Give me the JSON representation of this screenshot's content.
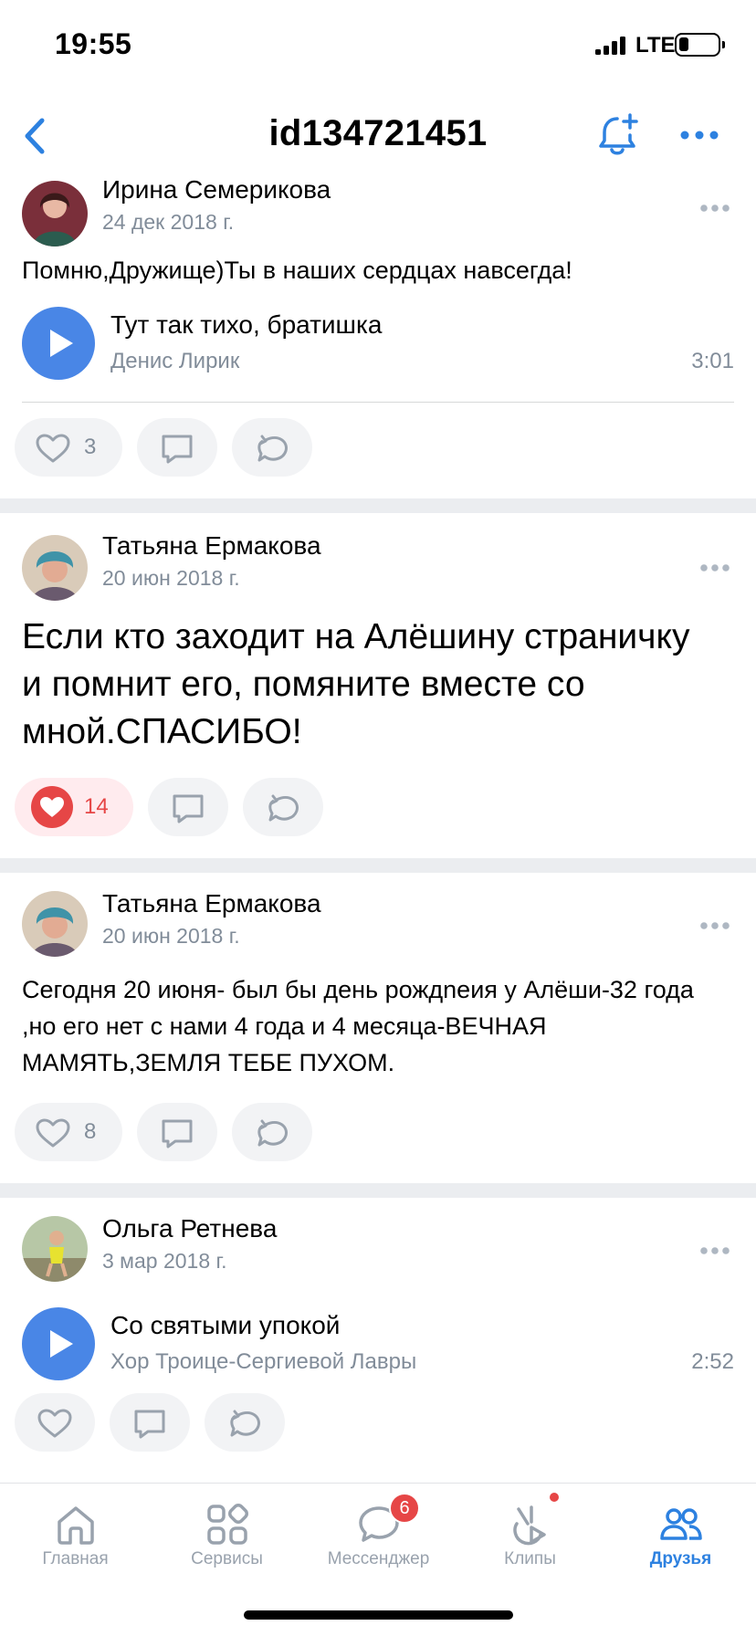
{
  "status_bar": {
    "time": "19:55",
    "network": "LTE",
    "battery_level": 0.15
  },
  "nav": {
    "title": "id134721451",
    "back_icon": "chevron-left-icon",
    "bell_icon": "bell-plus-icon",
    "more_icon": "more-horizontal-icon"
  },
  "posts": [
    {
      "author": "Ирина Семерикова",
      "date": "24 дек 2018 г.",
      "text": "Помню,Дружище)Ты в наших сердцах навсегда!",
      "audio": {
        "title": "Тут так тихо, братишка",
        "artist": "Денис Лирик",
        "duration": "3:01"
      },
      "likes": "3",
      "liked": false
    },
    {
      "author": "Татьяна Ермакова",
      "date": "20 июн 2018 г.",
      "text": "Если кто заходит на Алёшину страничку и помнит его, помяните вместе со мной.СПАСИБО!",
      "likes": "14",
      "liked": true
    },
    {
      "author": "Татьяна Ермакова",
      "date": "20 июн 2018 г.",
      "text": "Сегодня 20 июня- был бы день рождneия у Алёши-32 года ,но его нет с нами 4 года и 4 месяца-ВЕЧНАЯ МАМЯТЬ,ЗЕМЛЯ ТЕБЕ ПУХОМ.",
      "likes": "8",
      "liked": false
    },
    {
      "author": "Ольга Ретнева",
      "date": "3 мар 2018 г.",
      "audio": {
        "title": "Со святыми упокой",
        "artist": "Хор Троице-Сергиевой Лавры",
        "duration": "2:52"
      },
      "likes": "",
      "liked": false
    }
  ],
  "tabs": [
    {
      "label": "Главная",
      "icon": "home-icon",
      "active": false
    },
    {
      "label": "Сервисы",
      "icon": "services-grid-icon",
      "active": false
    },
    {
      "label": "Мессенджер",
      "icon": "messenger-icon",
      "active": false,
      "badge": "6"
    },
    {
      "label": "Клипы",
      "icon": "clips-icon",
      "active": false,
      "dot": true
    },
    {
      "label": "Друзья",
      "icon": "friends-icon",
      "active": true
    }
  ],
  "colors": {
    "accent": "#2d81e0",
    "play": "#4986e6",
    "like": "#e64646",
    "secondary_text": "#818c99",
    "separator": "#ebedf0"
  }
}
